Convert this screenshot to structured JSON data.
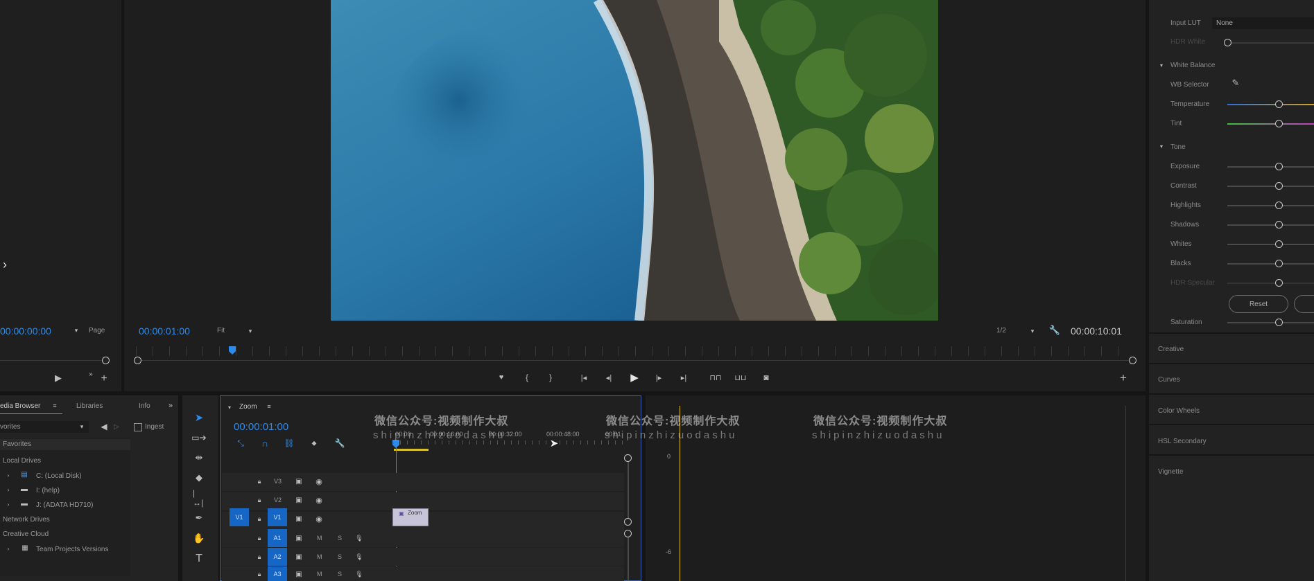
{
  "source_monitor": {
    "timecode": "00:00:00:00",
    "page_label": "Page"
  },
  "program_monitor": {
    "timecode_left": "00:00:01:00",
    "fit_label": "Fit",
    "resolution": "1/2",
    "timecode_right": "00:00:10:01"
  },
  "lumetri": {
    "input_lut_label": "Input LUT",
    "input_lut_value": "None",
    "hdr_white_label": "HDR White",
    "white_balance_label": "White Balance",
    "wb_selector_label": "WB Selector",
    "temperature_label": "Temperature",
    "tint_label": "Tint",
    "tone_label": "Tone",
    "exposure_label": "Exposure",
    "contrast_label": "Contrast",
    "highlights_label": "Highlights",
    "shadows_label": "Shadows",
    "whites_label": "Whites",
    "blacks_label": "Blacks",
    "hdr_specular_label": "HDR Specular",
    "reset_label": "Reset",
    "saturation_label": "Saturation",
    "sections": [
      "Creative",
      "Curves",
      "Color Wheels",
      "HSL Secondary",
      "Vignette"
    ]
  },
  "project_panel": {
    "tabs": [
      "edia Browser",
      "Libraries",
      "Info"
    ],
    "dropdown_value": "vorites",
    "ingest_label": "Ingest",
    "tree": {
      "favorites": "Favorites",
      "local_drives": "Local Drives",
      "drive_c": "C: (Local Disk)",
      "drive_i": "I: (help)",
      "drive_j": "J: (ADATA HD710)",
      "network_drives": "Network Drives",
      "creative_cloud": "Creative Cloud",
      "team_projects": "Team Projects Versions"
    }
  },
  "timeline": {
    "sequence_name": "Zoom",
    "timecode": "00:00:01:00",
    "ruler": [
      "00:00",
      "00:00:16:00",
      "00:00:32:00",
      "00:00:48:00",
      "00:01"
    ],
    "tracks_video": [
      "V3",
      "V2",
      "V1"
    ],
    "tracks_audio": [
      "A1",
      "A2",
      "A3"
    ],
    "source_patch_v": "V1",
    "clip_label": "Zoom",
    "audio_meter_ticks": [
      "0",
      "-6"
    ]
  },
  "watermark": {
    "line1": "微信公众号:视频制作大叔",
    "line2": "shipinzhizuodashu"
  },
  "colors": {
    "accent_blue": "#2d8ceb",
    "track_blue": "#1666c5",
    "panel": "#232323",
    "temperature_gradient": [
      "#2a6fd6",
      "#d6a02a"
    ],
    "tint_gradient": [
      "#3ec23e",
      "#c23ec2"
    ],
    "playhead_yellow": "#d8c12a"
  }
}
